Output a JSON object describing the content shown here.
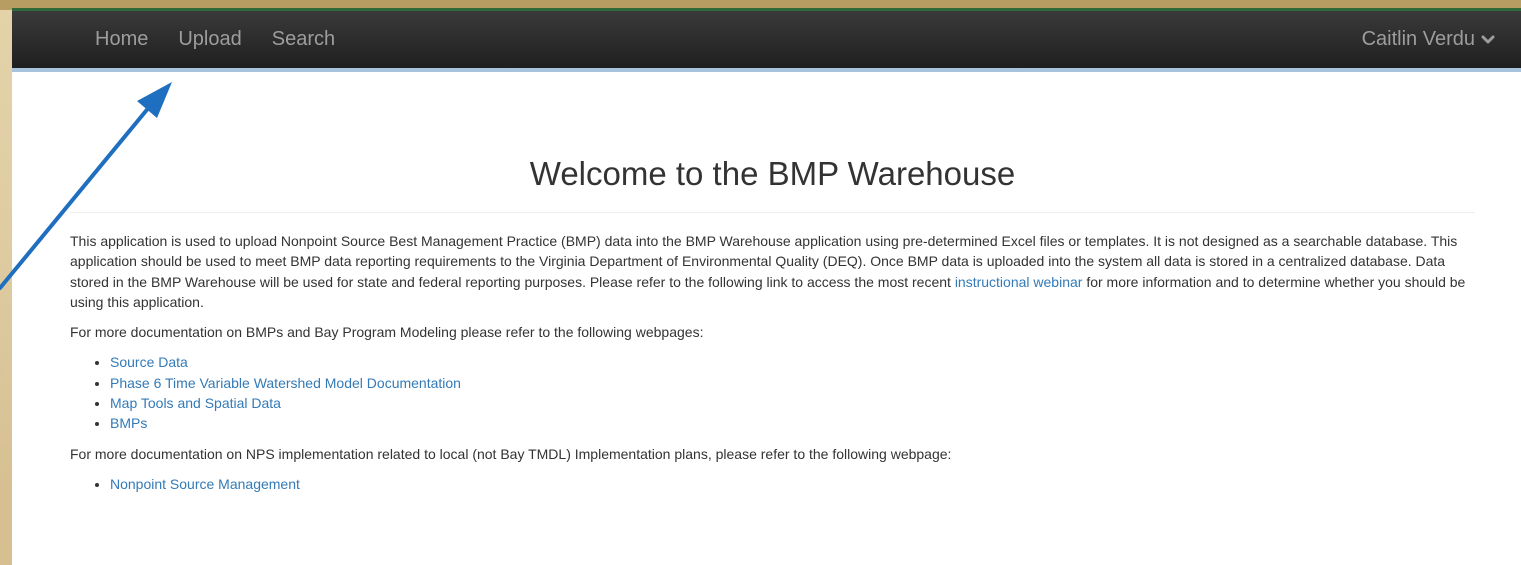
{
  "nav": {
    "links": [
      "Home",
      "Upload",
      "Search"
    ],
    "user": "Caitlin Verdu"
  },
  "page": {
    "title": "Welcome to the BMP Warehouse",
    "intro_before_link": "This application is used to upload Nonpoint Source Best Management Practice (BMP) data into the BMP Warehouse application using pre-determined Excel files or templates. It is not designed as a searchable database. This application should be used to meet BMP data reporting requirements to the Virginia Department of Environmental Quality (DEQ). Once BMP data is uploaded into the system all data is stored in a centralized database. Data stored in the BMP Warehouse will be used for state and federal reporting purposes. Please refer to the following link to access the most recent",
    "intro_link": "instructional webinar",
    "intro_after_link": "for more information and to determine whether you should be using this application.",
    "bay_docs_text": "For more documentation on BMPs and Bay Program Modeling please refer to the following webpages:",
    "bay_links": [
      "Source Data",
      "Phase 6 Time Variable Watershed Model Documentation",
      "Map Tools and Spatial Data",
      "BMPs"
    ],
    "nps_docs_text": "For more documentation on NPS implementation related to local (not Bay TMDL) Implementation plans, please refer to the following webpage:",
    "nps_links": [
      "Nonpoint Source Management"
    ]
  },
  "colors": {
    "navbar": "#222222",
    "link": "#337ab7",
    "annotation_arrow": "#1f6fc0",
    "desk_background": "#e2cfa2"
  }
}
